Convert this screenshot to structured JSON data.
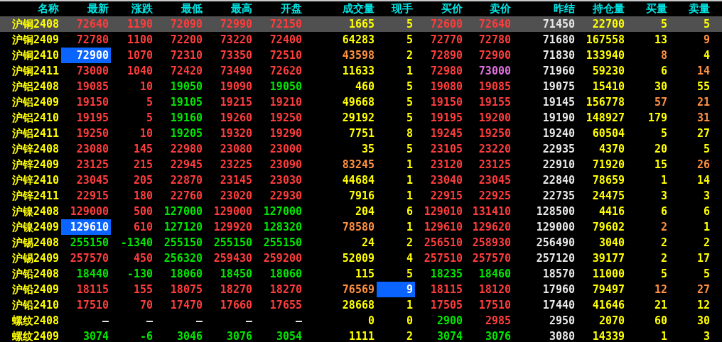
{
  "columns": [
    "名称",
    "最新",
    "涨跌",
    "最低",
    "最高",
    "开盘",
    "成交量",
    "现手",
    "买价",
    "卖价",
    "昨结",
    "持仓量",
    "买量",
    "卖量"
  ],
  "rows": [
    {
      "name": "沪铜2408",
      "selected": true,
      "cells": [
        {
          "text": "72640",
          "color": "#ff3c3c"
        },
        {
          "text": "1190",
          "color": "#ff3c3c"
        },
        {
          "text": "72090",
          "color": "#ff3c3c"
        },
        {
          "text": "72990",
          "color": "#ff3c3c"
        },
        {
          "text": "72150",
          "color": "#ff3c3c"
        },
        {
          "text": "1665",
          "color": "#ffff00"
        },
        {
          "text": "5",
          "color": "#ffff00"
        },
        {
          "text": "72600",
          "color": "#ff3c3c"
        },
        {
          "text": "72640",
          "color": "#ff3c3c"
        },
        {
          "text": "71450",
          "color": "#e8e8e8"
        },
        {
          "text": "22700",
          "color": "#ffff00"
        },
        {
          "text": "5",
          "color": "#ffff00"
        },
        {
          "text": "5",
          "color": "#ffff00"
        }
      ]
    },
    {
      "name": "沪铜2409",
      "selected": false,
      "cells": [
        {
          "text": "72780",
          "color": "#ff3c3c"
        },
        {
          "text": "1100",
          "color": "#ff3c3c"
        },
        {
          "text": "72200",
          "color": "#ff3c3c"
        },
        {
          "text": "73220",
          "color": "#ff3c3c"
        },
        {
          "text": "72400",
          "color": "#ff3c3c"
        },
        {
          "text": "64283",
          "color": "#ffff00"
        },
        {
          "text": "5",
          "color": "#ffff00"
        },
        {
          "text": "72770",
          "color": "#ff3c3c"
        },
        {
          "text": "72780",
          "color": "#ff3c3c"
        },
        {
          "text": "71680",
          "color": "#e8e8e8"
        },
        {
          "text": "167558",
          "color": "#ffff00"
        },
        {
          "text": "13",
          "color": "#ffff00"
        },
        {
          "text": "9",
          "color": "#ff9040"
        }
      ]
    },
    {
      "name": "沪铜2410",
      "selected": false,
      "cells": [
        {
          "text": "72900",
          "color": "#ffffff",
          "highlighted": true
        },
        {
          "text": "1070",
          "color": "#ff3c3c"
        },
        {
          "text": "72310",
          "color": "#ff3c3c"
        },
        {
          "text": "73350",
          "color": "#ff3c3c"
        },
        {
          "text": "72510",
          "color": "#ff3c3c"
        },
        {
          "text": "43598",
          "color": "#ff9040"
        },
        {
          "text": "2",
          "color": "#ffff00"
        },
        {
          "text": "72890",
          "color": "#ff3c3c"
        },
        {
          "text": "72900",
          "color": "#ff3c3c"
        },
        {
          "text": "71830",
          "color": "#e8e8e8"
        },
        {
          "text": "133940",
          "color": "#ffff00"
        },
        {
          "text": "8",
          "color": "#ff9040"
        },
        {
          "text": "4",
          "color": "#ffff00"
        }
      ]
    },
    {
      "name": "沪铜2411",
      "selected": false,
      "cells": [
        {
          "text": "73000",
          "color": "#ff3c3c"
        },
        {
          "text": "1040",
          "color": "#ff3c3c"
        },
        {
          "text": "72420",
          "color": "#ff3c3c"
        },
        {
          "text": "73490",
          "color": "#ff3c3c"
        },
        {
          "text": "72620",
          "color": "#ff3c3c"
        },
        {
          "text": "11633",
          "color": "#ffff00"
        },
        {
          "text": "1",
          "color": "#ffff00"
        },
        {
          "text": "72980",
          "color": "#ff3c3c"
        },
        {
          "text": "73000",
          "color": "#e070e0"
        },
        {
          "text": "71960",
          "color": "#e8e8e8"
        },
        {
          "text": "59230",
          "color": "#ffff00"
        },
        {
          "text": "6",
          "color": "#ffff00"
        },
        {
          "text": "14",
          "color": "#ff9040"
        }
      ]
    },
    {
      "name": "沪铝2408",
      "selected": false,
      "cells": [
        {
          "text": "19085",
          "color": "#ff3c3c"
        },
        {
          "text": "10",
          "color": "#ff3c3c"
        },
        {
          "text": "19050",
          "color": "#00e600"
        },
        {
          "text": "19090",
          "color": "#ff3c3c"
        },
        {
          "text": "19050",
          "color": "#00e600"
        },
        {
          "text": "460",
          "color": "#ffff00"
        },
        {
          "text": "5",
          "color": "#ffff00"
        },
        {
          "text": "19080",
          "color": "#ff3c3c"
        },
        {
          "text": "19085",
          "color": "#ff3c3c"
        },
        {
          "text": "19075",
          "color": "#e8e8e8"
        },
        {
          "text": "15410",
          "color": "#ffff00"
        },
        {
          "text": "30",
          "color": "#ffff00"
        },
        {
          "text": "55",
          "color": "#ffff00"
        }
      ]
    },
    {
      "name": "沪铝2409",
      "selected": false,
      "cells": [
        {
          "text": "19150",
          "color": "#ff3c3c"
        },
        {
          "text": "5",
          "color": "#ff3c3c"
        },
        {
          "text": "19105",
          "color": "#00e600"
        },
        {
          "text": "19215",
          "color": "#ff3c3c"
        },
        {
          "text": "19210",
          "color": "#ff3c3c"
        },
        {
          "text": "49668",
          "color": "#ffff00"
        },
        {
          "text": "5",
          "color": "#ffff00"
        },
        {
          "text": "19150",
          "color": "#ff3c3c"
        },
        {
          "text": "19155",
          "color": "#ff3c3c"
        },
        {
          "text": "19145",
          "color": "#e8e8e8"
        },
        {
          "text": "156778",
          "color": "#ffff00"
        },
        {
          "text": "57",
          "color": "#ff9040"
        },
        {
          "text": "21",
          "color": "#ff9040"
        }
      ]
    },
    {
      "name": "沪铝2410",
      "selected": false,
      "cells": [
        {
          "text": "19195",
          "color": "#ff3c3c"
        },
        {
          "text": "5",
          "color": "#ff3c3c"
        },
        {
          "text": "19160",
          "color": "#00e600"
        },
        {
          "text": "19260",
          "color": "#ff3c3c"
        },
        {
          "text": "19250",
          "color": "#ff3c3c"
        },
        {
          "text": "29192",
          "color": "#ffff00"
        },
        {
          "text": "5",
          "color": "#ffff00"
        },
        {
          "text": "19195",
          "color": "#ff3c3c"
        },
        {
          "text": "19200",
          "color": "#ff3c3c"
        },
        {
          "text": "19190",
          "color": "#e8e8e8"
        },
        {
          "text": "148927",
          "color": "#ffff00"
        },
        {
          "text": "179",
          "color": "#ffff00"
        },
        {
          "text": "31",
          "color": "#ff9040"
        }
      ]
    },
    {
      "name": "沪铝2411",
      "selected": false,
      "cells": [
        {
          "text": "19250",
          "color": "#ff3c3c"
        },
        {
          "text": "10",
          "color": "#ff3c3c"
        },
        {
          "text": "19205",
          "color": "#00e600"
        },
        {
          "text": "19320",
          "color": "#ff3c3c"
        },
        {
          "text": "19290",
          "color": "#ff3c3c"
        },
        {
          "text": "7751",
          "color": "#ffff00"
        },
        {
          "text": "8",
          "color": "#ffff00"
        },
        {
          "text": "19245",
          "color": "#ff3c3c"
        },
        {
          "text": "19250",
          "color": "#ff3c3c"
        },
        {
          "text": "19240",
          "color": "#e8e8e8"
        },
        {
          "text": "60504",
          "color": "#ffff00"
        },
        {
          "text": "5",
          "color": "#ffff00"
        },
        {
          "text": "27",
          "color": "#ffff00"
        }
      ]
    },
    {
      "name": "沪锌2408",
      "selected": false,
      "cells": [
        {
          "text": "23080",
          "color": "#ff3c3c"
        },
        {
          "text": "145",
          "color": "#ff3c3c"
        },
        {
          "text": "22980",
          "color": "#ff3c3c"
        },
        {
          "text": "23080",
          "color": "#ff3c3c"
        },
        {
          "text": "23000",
          "color": "#ff3c3c"
        },
        {
          "text": "35",
          "color": "#ffff00"
        },
        {
          "text": "5",
          "color": "#ffff00"
        },
        {
          "text": "23105",
          "color": "#ff3c3c"
        },
        {
          "text": "23220",
          "color": "#ff3c3c"
        },
        {
          "text": "22935",
          "color": "#e8e8e8"
        },
        {
          "text": "4370",
          "color": "#ffff00"
        },
        {
          "text": "20",
          "color": "#ffff00"
        },
        {
          "text": "5",
          "color": "#ffff00"
        }
      ]
    },
    {
      "name": "沪锌2409",
      "selected": false,
      "cells": [
        {
          "text": "23125",
          "color": "#ff3c3c"
        },
        {
          "text": "215",
          "color": "#ff3c3c"
        },
        {
          "text": "22945",
          "color": "#ff3c3c"
        },
        {
          "text": "23225",
          "color": "#ff3c3c"
        },
        {
          "text": "23090",
          "color": "#ff3c3c"
        },
        {
          "text": "83245",
          "color": "#ff9040"
        },
        {
          "text": "1",
          "color": "#ffff00"
        },
        {
          "text": "23120",
          "color": "#ff3c3c"
        },
        {
          "text": "23125",
          "color": "#ff3c3c"
        },
        {
          "text": "22910",
          "color": "#e8e8e8"
        },
        {
          "text": "71920",
          "color": "#ffff00"
        },
        {
          "text": "15",
          "color": "#ffff00"
        },
        {
          "text": "26",
          "color": "#ff9040"
        }
      ]
    },
    {
      "name": "沪锌2410",
      "selected": false,
      "cells": [
        {
          "text": "23045",
          "color": "#ff3c3c"
        },
        {
          "text": "205",
          "color": "#ff3c3c"
        },
        {
          "text": "22870",
          "color": "#ff3c3c"
        },
        {
          "text": "23145",
          "color": "#ff3c3c"
        },
        {
          "text": "23030",
          "color": "#ff3c3c"
        },
        {
          "text": "44684",
          "color": "#ffff00"
        },
        {
          "text": "1",
          "color": "#ffff00"
        },
        {
          "text": "23040",
          "color": "#ff3c3c"
        },
        {
          "text": "23045",
          "color": "#ff3c3c"
        },
        {
          "text": "22840",
          "color": "#e8e8e8"
        },
        {
          "text": "78659",
          "color": "#ffff00"
        },
        {
          "text": "1",
          "color": "#ffff00"
        },
        {
          "text": "14",
          "color": "#ffff00"
        }
      ]
    },
    {
      "name": "沪锌2411",
      "selected": false,
      "cells": [
        {
          "text": "22915",
          "color": "#ff3c3c"
        },
        {
          "text": "180",
          "color": "#ff3c3c"
        },
        {
          "text": "22760",
          "color": "#ff3c3c"
        },
        {
          "text": "23020",
          "color": "#ff3c3c"
        },
        {
          "text": "22930",
          "color": "#ff3c3c"
        },
        {
          "text": "7916",
          "color": "#ffff00"
        },
        {
          "text": "1",
          "color": "#ffff00"
        },
        {
          "text": "22915",
          "color": "#ff3c3c"
        },
        {
          "text": "22925",
          "color": "#ff3c3c"
        },
        {
          "text": "22735",
          "color": "#e8e8e8"
        },
        {
          "text": "24475",
          "color": "#ffff00"
        },
        {
          "text": "3",
          "color": "#ffff00"
        },
        {
          "text": "3",
          "color": "#ffff00"
        }
      ]
    },
    {
      "name": "沪镍2408",
      "selected": false,
      "cells": [
        {
          "text": "129000",
          "color": "#ff3c3c"
        },
        {
          "text": "500",
          "color": "#ff3c3c"
        },
        {
          "text": "127000",
          "color": "#00e600"
        },
        {
          "text": "129000",
          "color": "#ff3c3c"
        },
        {
          "text": "127000",
          "color": "#00e600"
        },
        {
          "text": "204",
          "color": "#ffff00"
        },
        {
          "text": "6",
          "color": "#ffff00"
        },
        {
          "text": "129010",
          "color": "#ff3c3c"
        },
        {
          "text": "131410",
          "color": "#ff3c3c"
        },
        {
          "text": "128500",
          "color": "#e8e8e8"
        },
        {
          "text": "4416",
          "color": "#ffff00"
        },
        {
          "text": "6",
          "color": "#ffff00"
        },
        {
          "text": "6",
          "color": "#ffff00"
        }
      ]
    },
    {
      "name": "沪镍2409",
      "selected": false,
      "cells": [
        {
          "text": "129610",
          "color": "#ffffff",
          "highlighted": true
        },
        {
          "text": "610",
          "color": "#ff3c3c"
        },
        {
          "text": "127120",
          "color": "#00e600"
        },
        {
          "text": "129920",
          "color": "#ff3c3c"
        },
        {
          "text": "128320",
          "color": "#00e600"
        },
        {
          "text": "78580",
          "color": "#ff9040"
        },
        {
          "text": "1",
          "color": "#ffff00"
        },
        {
          "text": "129610",
          "color": "#ff3c3c"
        },
        {
          "text": "129620",
          "color": "#ff3c3c"
        },
        {
          "text": "129000",
          "color": "#e8e8e8"
        },
        {
          "text": "79602",
          "color": "#ffff00"
        },
        {
          "text": "2",
          "color": "#ff9040"
        },
        {
          "text": "1",
          "color": "#ffff00"
        }
      ]
    },
    {
      "name": "沪锡2408",
      "selected": false,
      "cells": [
        {
          "text": "255150",
          "color": "#00e600"
        },
        {
          "text": "-1340",
          "color": "#00e600"
        },
        {
          "text": "255150",
          "color": "#00e600"
        },
        {
          "text": "255150",
          "color": "#00e600"
        },
        {
          "text": "255150",
          "color": "#00e600"
        },
        {
          "text": "24",
          "color": "#ffff00"
        },
        {
          "text": "2",
          "color": "#ffff00"
        },
        {
          "text": "256510",
          "color": "#ff3c3c"
        },
        {
          "text": "258930",
          "color": "#ff3c3c"
        },
        {
          "text": "256490",
          "color": "#e8e8e8"
        },
        {
          "text": "3040",
          "color": "#ffff00"
        },
        {
          "text": "2",
          "color": "#ffff00"
        },
        {
          "text": "2",
          "color": "#ffff00"
        }
      ]
    },
    {
      "name": "沪锡2409",
      "selected": false,
      "cells": [
        {
          "text": "257570",
          "color": "#ff3c3c"
        },
        {
          "text": "450",
          "color": "#ff3c3c"
        },
        {
          "text": "256320",
          "color": "#00e600"
        },
        {
          "text": "259430",
          "color": "#ff3c3c"
        },
        {
          "text": "259200",
          "color": "#ff3c3c"
        },
        {
          "text": "52009",
          "color": "#ffff00"
        },
        {
          "text": "4",
          "color": "#ffff00"
        },
        {
          "text": "257510",
          "color": "#ff3c3c"
        },
        {
          "text": "257570",
          "color": "#ff3c3c"
        },
        {
          "text": "257120",
          "color": "#e8e8e8"
        },
        {
          "text": "39177",
          "color": "#ffff00"
        },
        {
          "text": "2",
          "color": "#ffff00"
        },
        {
          "text": "17",
          "color": "#ffff00"
        }
      ]
    },
    {
      "name": "沪铅2408",
      "selected": false,
      "cells": [
        {
          "text": "18440",
          "color": "#00e600"
        },
        {
          "text": "-130",
          "color": "#00e600"
        },
        {
          "text": "18060",
          "color": "#00e600"
        },
        {
          "text": "18450",
          "color": "#00e600"
        },
        {
          "text": "18060",
          "color": "#00e600"
        },
        {
          "text": "115",
          "color": "#ffff00"
        },
        {
          "text": "5",
          "color": "#ffff00"
        },
        {
          "text": "18235",
          "color": "#00e600"
        },
        {
          "text": "18460",
          "color": "#00e600"
        },
        {
          "text": "18570",
          "color": "#e8e8e8"
        },
        {
          "text": "11000",
          "color": "#ffff00"
        },
        {
          "text": "5",
          "color": "#ffff00"
        },
        {
          "text": "5",
          "color": "#ffff00"
        }
      ]
    },
    {
      "name": "沪铅2409",
      "selected": false,
      "cells": [
        {
          "text": "18115",
          "color": "#ff3c3c"
        },
        {
          "text": "155",
          "color": "#ff3c3c"
        },
        {
          "text": "18075",
          "color": "#ff3c3c"
        },
        {
          "text": "18270",
          "color": "#ff3c3c"
        },
        {
          "text": "18270",
          "color": "#ff3c3c"
        },
        {
          "text": "76569",
          "color": "#ff9040"
        },
        {
          "text": "9",
          "color": "#ffffff",
          "highlighted": true
        },
        {
          "text": "18115",
          "color": "#ff3c3c"
        },
        {
          "text": "18120",
          "color": "#ff3c3c"
        },
        {
          "text": "17960",
          "color": "#e8e8e8"
        },
        {
          "text": "79497",
          "color": "#ffff00"
        },
        {
          "text": "12",
          "color": "#ff9040"
        },
        {
          "text": "27",
          "color": "#ff9040"
        }
      ]
    },
    {
      "name": "沪铅2410",
      "selected": false,
      "cells": [
        {
          "text": "17510",
          "color": "#ff3c3c"
        },
        {
          "text": "70",
          "color": "#ff3c3c"
        },
        {
          "text": "17470",
          "color": "#ff3c3c"
        },
        {
          "text": "17660",
          "color": "#ff3c3c"
        },
        {
          "text": "17655",
          "color": "#ff3c3c"
        },
        {
          "text": "28668",
          "color": "#ffff00"
        },
        {
          "text": "1",
          "color": "#ffff00"
        },
        {
          "text": "17505",
          "color": "#ff3c3c"
        },
        {
          "text": "17510",
          "color": "#ff3c3c"
        },
        {
          "text": "17440",
          "color": "#e8e8e8"
        },
        {
          "text": "41646",
          "color": "#ffff00"
        },
        {
          "text": "21",
          "color": "#ffff00"
        },
        {
          "text": "12",
          "color": "#ffff00"
        }
      ]
    },
    {
      "name": "螺纹2408",
      "selected": false,
      "cells": [
        {
          "text": "—",
          "color": "#e8e8e8"
        },
        {
          "text": "—",
          "color": "#e8e8e8"
        },
        {
          "text": "—",
          "color": "#e8e8e8"
        },
        {
          "text": "—",
          "color": "#e8e8e8"
        },
        {
          "text": "—",
          "color": "#e8e8e8"
        },
        {
          "text": "0",
          "color": "#ffff00"
        },
        {
          "text": "0",
          "color": "#ffff00"
        },
        {
          "text": "2900",
          "color": "#00e600"
        },
        {
          "text": "2985",
          "color": "#ff3c3c"
        },
        {
          "text": "2950",
          "color": "#e8e8e8"
        },
        {
          "text": "2070",
          "color": "#ffff00"
        },
        {
          "text": "60",
          "color": "#ffff00"
        },
        {
          "text": "30",
          "color": "#ffff00"
        }
      ]
    },
    {
      "name": "螺纹2409",
      "selected": false,
      "cells": [
        {
          "text": "3074",
          "color": "#00e600"
        },
        {
          "text": "-6",
          "color": "#00e600"
        },
        {
          "text": "3046",
          "color": "#00e600"
        },
        {
          "text": "3076",
          "color": "#00e600"
        },
        {
          "text": "3054",
          "color": "#00e600"
        },
        {
          "text": "1111",
          "color": "#ffff00"
        },
        {
          "text": "2",
          "color": "#ffff00"
        },
        {
          "text": "3074",
          "color": "#00e600"
        },
        {
          "text": "3076",
          "color": "#00e600"
        },
        {
          "text": "3080",
          "color": "#e8e8e8"
        },
        {
          "text": "14339",
          "color": "#ffff00"
        },
        {
          "text": "1",
          "color": "#ffff00"
        },
        {
          "text": "3",
          "color": "#ffff00"
        }
      ]
    }
  ]
}
